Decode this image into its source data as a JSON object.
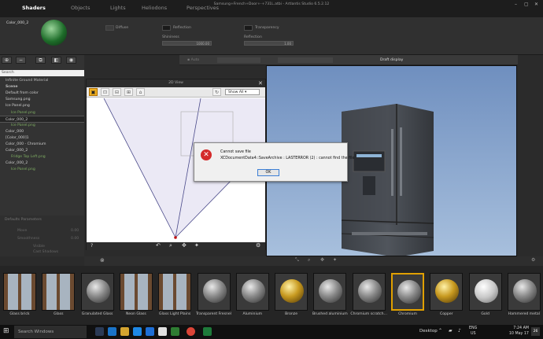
{
  "titlebar": {
    "tabs": [
      "Shaders",
      "Objects",
      "Lights",
      "Heliodons",
      "Perspectives"
    ],
    "active_tab": "Shaders",
    "window_title": "Samsung+French+Door+-+731L.atbi - Artlantis Studio 6.5.2.12"
  },
  "material_bar": {
    "material_name": "Color_000_2",
    "diffuse_label": "Diffuse",
    "reflection_label": "Reflection",
    "transparency_label": "Transparency",
    "shininess_label": "Shininess",
    "shininess_value": "1000.00",
    "reflection2_label": "Reflection",
    "reflection_value": "1.00"
  },
  "left_panel": {
    "search_placeholder": "Search",
    "items": [
      {
        "label": "Infinite Ground Material",
        "type": "hdr"
      },
      {
        "label": "Scene",
        "type": "hdr"
      },
      {
        "label": "Default from color",
        "type": "item"
      },
      {
        "label": "Samsung.png",
        "type": "item"
      },
      {
        "label": "Ice Panel.png",
        "type": "item"
      },
      {
        "label": "Ice Panel.png",
        "type": "sub"
      },
      {
        "label": "Color_000_2",
        "type": "sel"
      },
      {
        "label": "Ice Panel.png",
        "type": "sub"
      },
      {
        "label": "Color_000",
        "type": "item"
      },
      {
        "label": "[Color_000]1",
        "type": "item"
      },
      {
        "label": "Color_000 - Chromium",
        "type": "item"
      },
      {
        "label": "Color_000_2",
        "type": "item"
      },
      {
        "label": "Fridge Top Left.png",
        "type": "sub"
      },
      {
        "label": "Color_000_2",
        "type": "item"
      },
      {
        "label": "Ice Panel.png",
        "type": "sub"
      }
    ],
    "params_title": "Defaults Parameters",
    "param1_label": "Move",
    "param1_value": "0.00",
    "param2_label": "Smoothness",
    "param2_value": "0.00",
    "check1": "Visible",
    "check2": "Cast Shadows",
    "check3": "Receive Shadows"
  },
  "view2d": {
    "title": "2D View",
    "show_all": "Show All",
    "help": "?"
  },
  "render_toolbar": {
    "draft_display": "Draft display"
  },
  "dialog": {
    "title": "Cannot save file",
    "message": "XCDocumentData4::SaveArchive : LASTERROR (2) : cannot find the file",
    "ok_label": "OK"
  },
  "catalog": [
    {
      "label": "Glass brick",
      "kind": "glass",
      "selected": false
    },
    {
      "label": "Glass",
      "kind": "glass",
      "selected": false
    },
    {
      "label": "Granulated Glass",
      "kind": "grey",
      "selected": false
    },
    {
      "label": "Neon Glass",
      "kind": "glass",
      "selected": false
    },
    {
      "label": "Glass Light Plains",
      "kind": "glass",
      "selected": false
    },
    {
      "label": "Transparent Fresnel",
      "kind": "grey",
      "selected": false
    },
    {
      "label": "Aluminium",
      "kind": "grey",
      "selected": false
    },
    {
      "label": "Bronze",
      "kind": "gold",
      "selected": false
    },
    {
      "label": "Brushed aluminium",
      "kind": "grey",
      "selected": false
    },
    {
      "label": "Chromium scratch...",
      "kind": "grey",
      "selected": false
    },
    {
      "label": "Chromium",
      "kind": "grey",
      "selected": true
    },
    {
      "label": "Copper",
      "kind": "gold",
      "selected": false
    },
    {
      "label": "Gold",
      "kind": "white",
      "selected": false
    },
    {
      "label": "Hammered metal",
      "kind": "grey",
      "selected": false
    }
  ],
  "taskbar": {
    "search": "Search Windows",
    "desktop": "Desktop",
    "lang1": "ENG",
    "lang2": "US",
    "time": "7:24 AM",
    "date": "10 May 17",
    "notif": "26"
  },
  "colors": {
    "accent": "#e0a000",
    "error": "#d42a2a",
    "sky": "#8fb0d4"
  }
}
